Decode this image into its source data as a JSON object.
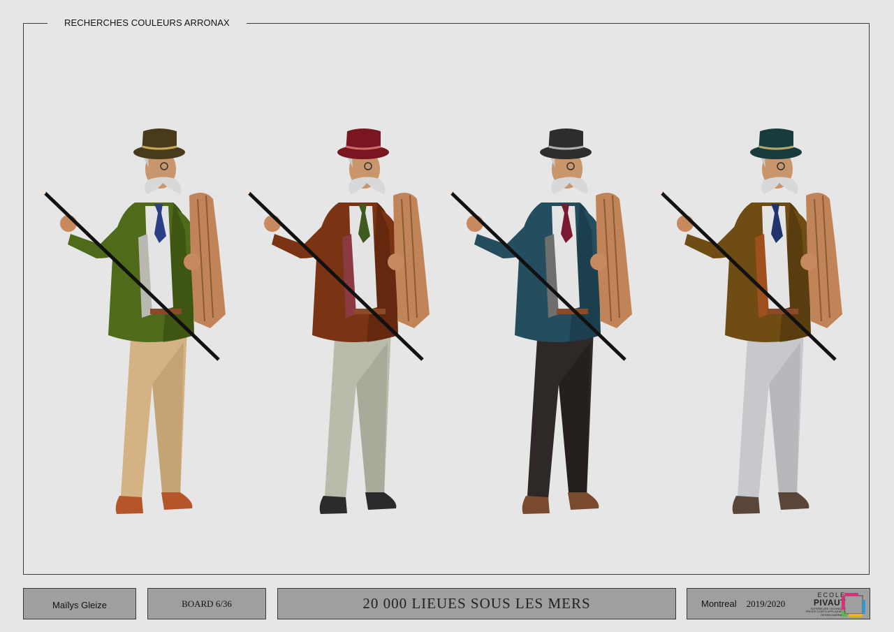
{
  "header": {
    "title": "RECHERCHES COULEURS ARRONAX"
  },
  "figures": [
    {
      "hat": "#4a3a1c",
      "hatBand": "#c8a85a",
      "jacket": "#4e6a1a",
      "jacketDark": "#35490f",
      "vest": "#b9b9b2",
      "tie": "#2a3f86",
      "pants": "#d4b283",
      "pantsDark": "#b49466",
      "shoes": "#b4552a"
    },
    {
      "hat": "#7a1620",
      "hatBand": "#d26a6a",
      "jacket": "#7a3414",
      "jacketDark": "#55220c",
      "vest": "#8c3a42",
      "tie": "#3e5a1c",
      "pants": "#b9bcaa",
      "pantsDark": "#979a88",
      "shoes": "#2b2b2b"
    },
    {
      "hat": "#2d2d2d",
      "hatBand": "#b0b0b0",
      "jacket": "#244e5e",
      "jacketDark": "#173642",
      "vest": "#6e6e6e",
      "tie": "#7a1a32",
      "pants": "#2e2826",
      "pantsDark": "#1c1816",
      "shoes": "#7a4a2e"
    },
    {
      "hat": "#183c3e",
      "hatBand": "#b8a86a",
      "jacket": "#6e4c14",
      "jacketDark": "#4c330b",
      "vest": "#a0501e",
      "tie": "#22346e",
      "pants": "#c6c8cb",
      "pantsDark": "#a6a8ab",
      "shoes": "#5a4638"
    }
  ],
  "footer": {
    "author": "Maïlys Gleize",
    "board": "BOARD 6/36",
    "project": "20 000 LIEUES SOUS LES MERS",
    "city": "Montreal",
    "year": "2019/2020"
  },
  "logo": {
    "ecole": "ECOLE",
    "pivaut": "PIVAUT",
    "subtitle": "SUPERIEURE TECHNIQUE PRIVEE D'ARTS APPLIQUES & DESSIN NARRATIF"
  }
}
